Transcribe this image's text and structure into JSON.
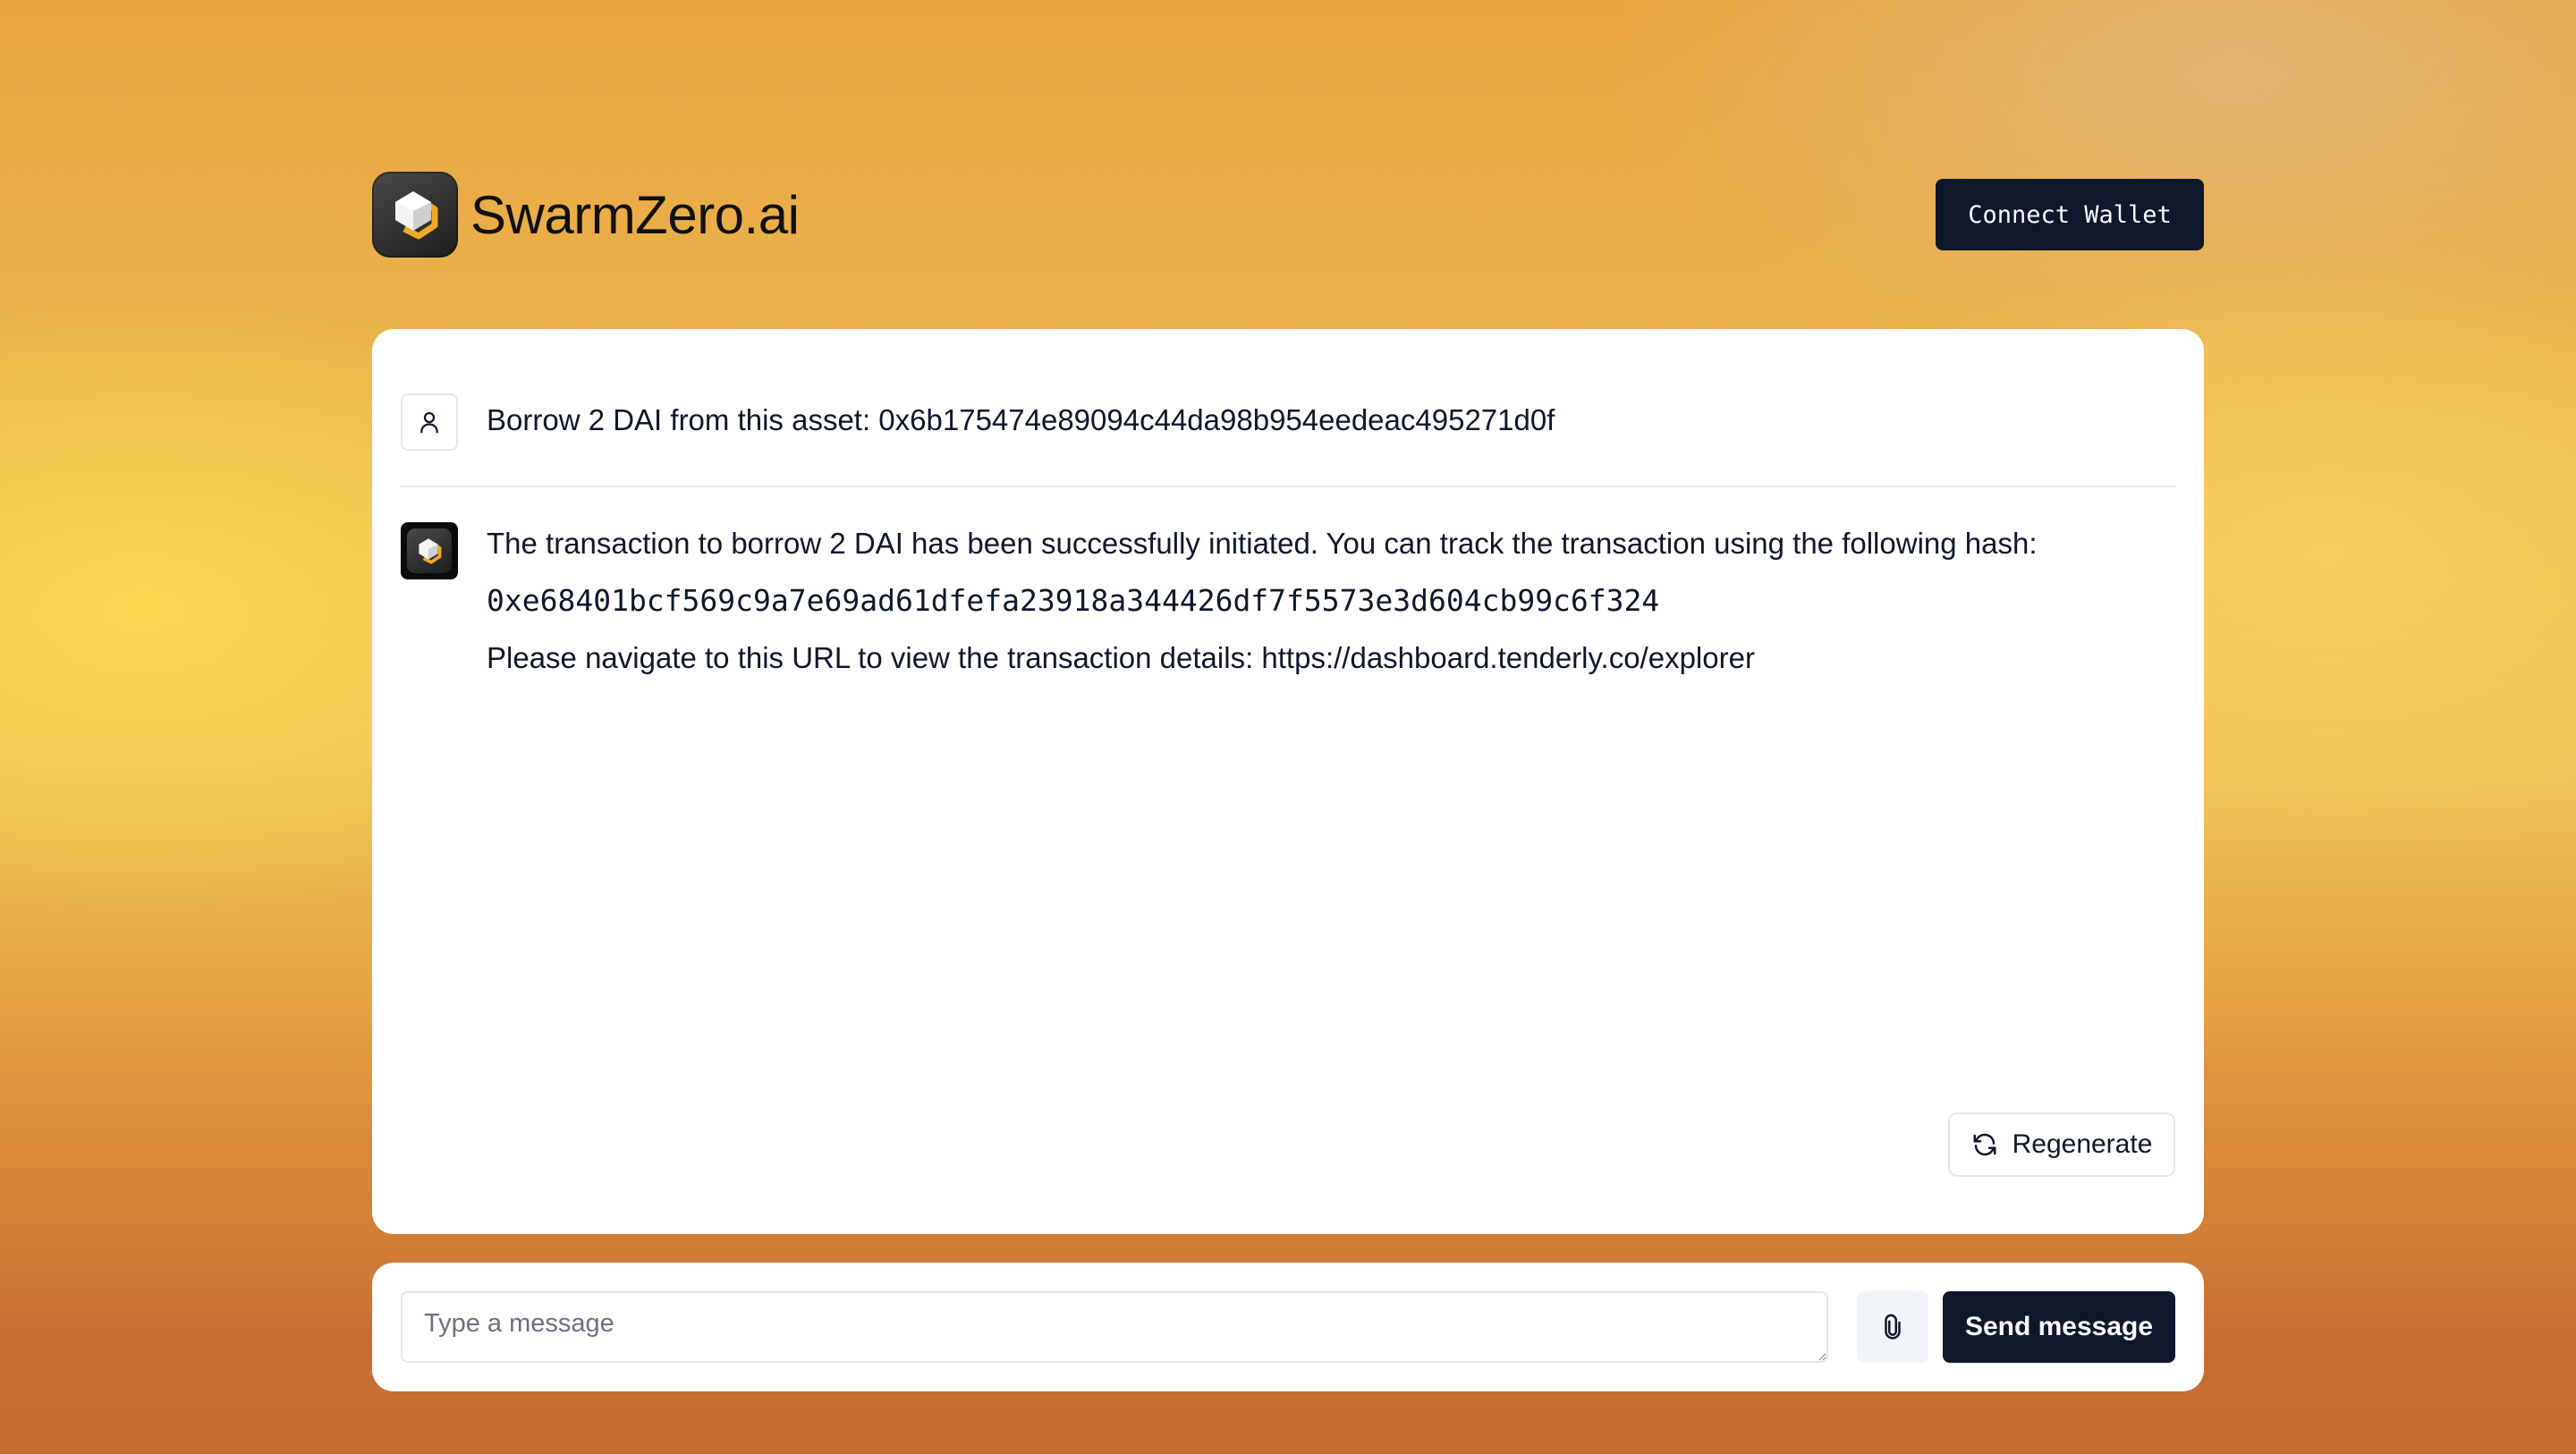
{
  "header": {
    "brand_name": "SwarmZero.ai",
    "logo_icon": "swarmzero-logo",
    "connect_wallet_label": "Connect Wallet"
  },
  "chat": {
    "messages": [
      {
        "role": "user",
        "avatar_icon": "user-icon",
        "text": "Borrow 2 DAI from this asset: 0x6b175474e89094c44da98b954eedeac495271d0f"
      },
      {
        "role": "assistant",
        "avatar_icon": "swarmzero-logo",
        "paragraphs": [
          "The transaction to borrow 2 DAI has been successfully initiated. You can track the transaction using the following hash:",
          "0xe68401bcf569c9a7e69ad61dfefa23918a344426df7f5573e3d604cb99c6f324",
          "Please navigate to this URL to view the transaction details: https://dashboard.tenderly.co/explorer"
        ]
      }
    ],
    "regenerate_label": "Regenerate",
    "regenerate_icon": "refresh-icon"
  },
  "composer": {
    "placeholder": "Type a message",
    "value": "",
    "attach_icon": "paperclip-icon",
    "send_label": "Send message"
  },
  "colors": {
    "primary_dark": "#0f172a",
    "border": "#e5e7eb",
    "muted_bg": "#f1f5f9"
  }
}
